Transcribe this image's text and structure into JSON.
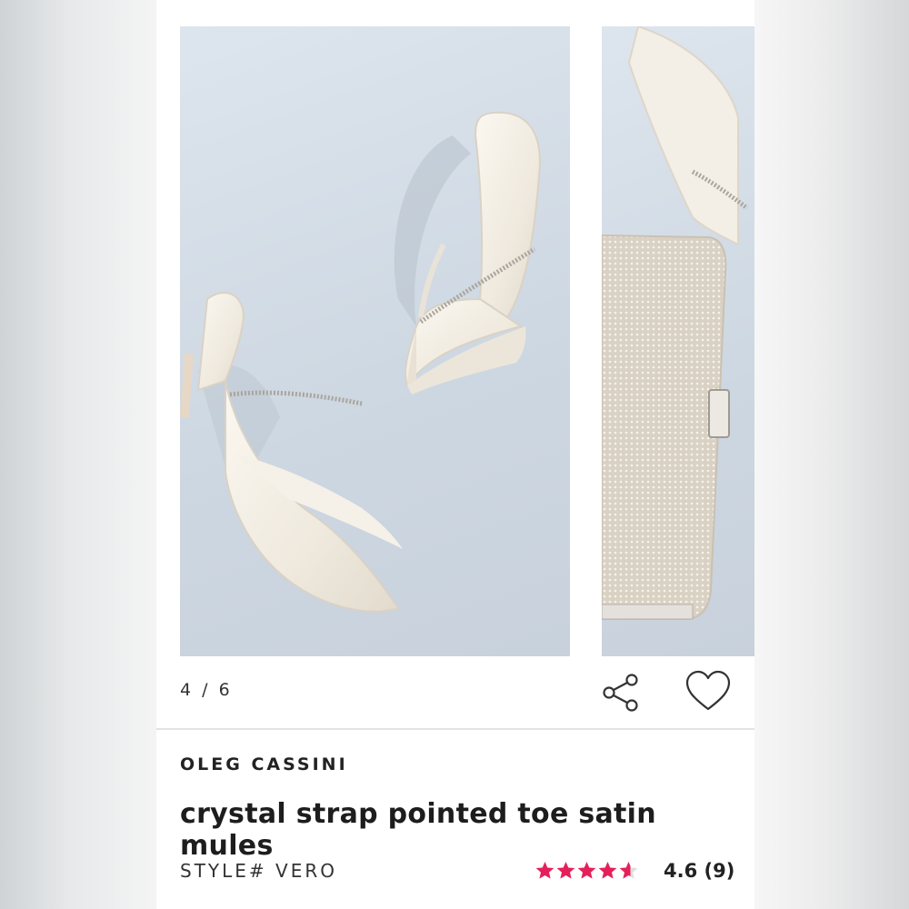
{
  "gallery": {
    "counter": "4 / 6",
    "images": [
      {
        "name": "crystal-strap-mules-photo"
      },
      {
        "name": "crystal-clutch-photo",
        "shoe_brand_stamp": "OLEG CASSINI"
      }
    ]
  },
  "actions": {
    "share_icon": "share-icon",
    "favorite_icon": "heart-icon"
  },
  "product": {
    "brand": "OLEG CASSINI",
    "name": "crystal strap pointed toe satin mules",
    "style": "STYLE# VERO",
    "rating_value": 4.6,
    "rating_text": "4.6 (9)",
    "rating_stars_max": 5
  },
  "colors": {
    "star": "#e4205a",
    "star_empty": "#dddddd",
    "background": "#ffffff"
  }
}
